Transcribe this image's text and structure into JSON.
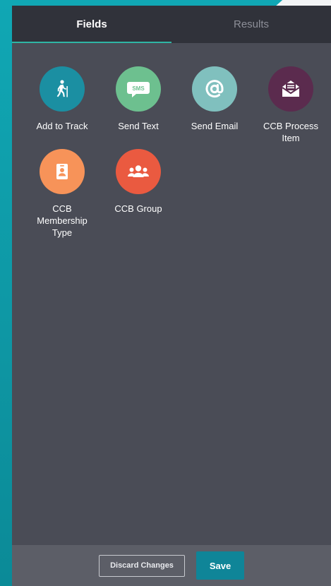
{
  "tabs": [
    {
      "label": "Fields",
      "active": true
    },
    {
      "label": "Results",
      "active": false
    }
  ],
  "actions": [
    {
      "label": "Add to Track",
      "icon": "hiker-icon",
      "color": "#1b8fa2"
    },
    {
      "label": "Send Text",
      "icon": "sms-icon",
      "color": "#6dc08f"
    },
    {
      "label": "Send Email",
      "icon": "at-sign-icon",
      "color": "#80c0be"
    },
    {
      "label": "CCB Process Item",
      "icon": "envelope-open-icon",
      "color": "#5b2b4e"
    },
    {
      "label": "CCB Membership Type",
      "icon": "id-badge-icon",
      "color": "#f79359"
    },
    {
      "label": "CCB Group",
      "icon": "group-icon",
      "color": "#ea5a40"
    }
  ],
  "sms_icon_text": "SMS",
  "footer": {
    "discard_label": "Discard Changes",
    "save_label": "Save"
  },
  "colors": {
    "panel": "#4a4c56",
    "tab_bar": "#30323a",
    "tab_underline": "#2fb5a4",
    "footer": "#5c5e67",
    "save_button": "#0f8598",
    "background": "#0f9aa8"
  }
}
